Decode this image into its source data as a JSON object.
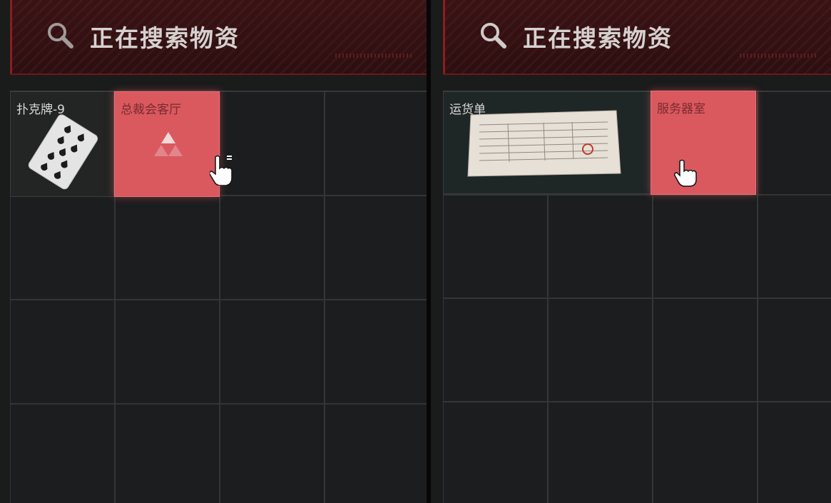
{
  "panels": [
    {
      "header_title": "正在搜索物资",
      "items": [
        {
          "label": "扑克牌-9",
          "image": "playing-card-spade-9"
        },
        {
          "label": "总裁会客厅",
          "image": "scan-triangle-icon"
        }
      ]
    },
    {
      "header_title": "正在搜索物资",
      "items": [
        {
          "label": "运货单",
          "image": "waybill-document"
        },
        {
          "label": "服务器室",
          "image": ""
        }
      ]
    }
  ],
  "colors": {
    "header_bg": "#3a1214",
    "highlight": "#d9595f",
    "grid_bg": "#1d1e1f"
  }
}
